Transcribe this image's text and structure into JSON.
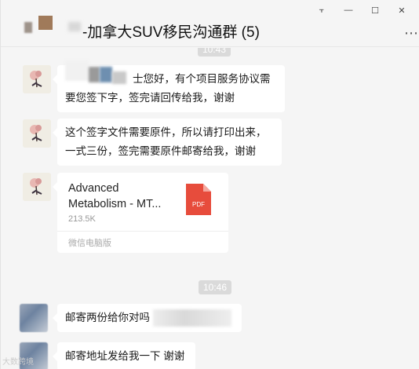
{
  "window": {
    "title": "-加拿大SUV移民沟通群 (5)",
    "pin_glyph": "⫟",
    "minimize_glyph": "—",
    "maximize_glyph": "☐",
    "close_glyph": "✕",
    "more_glyph": "⋯"
  },
  "messages": {
    "time_top": "10:43",
    "msg1_text": "士您好，有个项目服务协议需要您签下字，签完请回传给我，谢谢",
    "msg2_text": "这个签字文件需要原件，所以请打印出来，一式三份，签完需要原件邮寄给我，谢谢",
    "file": {
      "name": "Advanced Metabolism - MT...",
      "size": "213.5K",
      "source": "微信电脑版",
      "icon_label": "PDF",
      "icon_color": "#e74c3c"
    },
    "time_mid": "10:46",
    "msg3_text": "邮寄两份给你对吗",
    "msg4_text": "邮寄地址发给我一下 谢谢"
  },
  "watermark": "大数跨境"
}
